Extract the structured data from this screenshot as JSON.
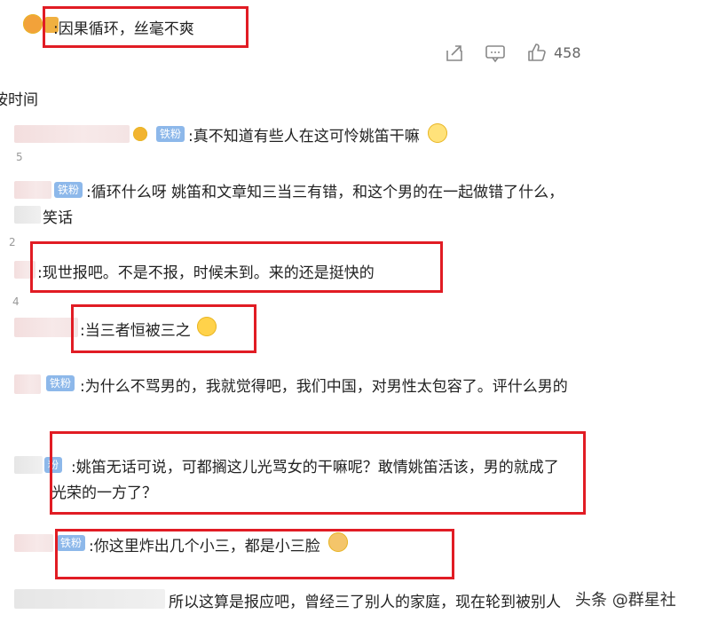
{
  "top": {
    "comment_text": ":因果循环，丝毫不爽",
    "like_count": "458"
  },
  "sort": {
    "label": "按时间"
  },
  "comments": [
    {
      "badge": "铁粉",
      "text": ":真不知道有些人在这可怜姚笛干嘛"
    },
    {
      "badge": "铁粉",
      "text": ":循环什么呀 姚笛和文章知三当三有错，和这个男的在一起做错了什么，",
      "text2": "笑话"
    },
    {
      "text": ":现世报吧。不是不报，时候未到。来的还是挺快的"
    },
    {
      "text": ":当三者恒被三之"
    },
    {
      "badge": "铁粉",
      "text": ":为什么不骂男的，我就觉得吧，我们中国，对男性太包容了。评什么男的"
    },
    {
      "badge": "粉",
      "text": ":姚笛无话可说，可都搁这儿光骂女的干嘛呢？敢情姚笛活该，男的就成了",
      "text2": "光荣的一方了？"
    },
    {
      "badge": "铁粉",
      "text": ":你这里炸出几个小三，都是小三脸"
    },
    {
      "text": "所以这算是报应吧，曾经三了别人的家庭，现在轮到被别人"
    }
  ],
  "side_fragments": [
    "5",
    "2",
    "4"
  ],
  "watermark": "头条 @群星社",
  "colors": {
    "highlight_box": "#e11c24",
    "badge_bg": "#8db8ea"
  }
}
